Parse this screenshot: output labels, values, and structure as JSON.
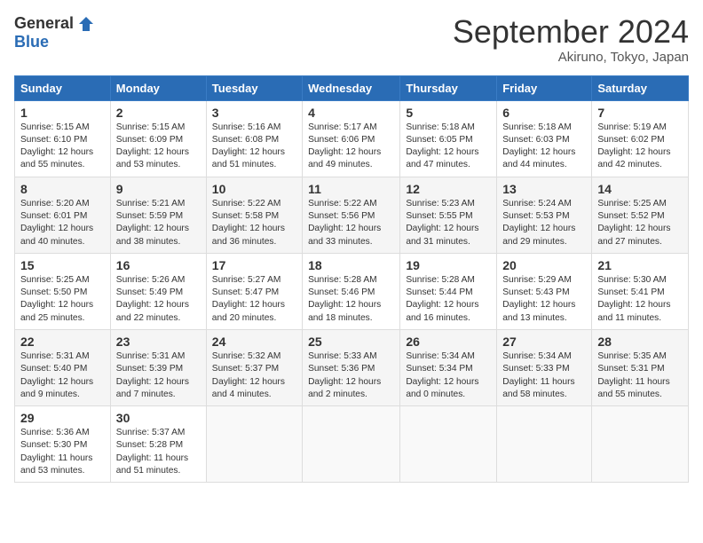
{
  "logo": {
    "general": "General",
    "blue": "Blue"
  },
  "title": "September 2024",
  "location": "Akiruno, Tokyo, Japan",
  "headers": [
    "Sunday",
    "Monday",
    "Tuesday",
    "Wednesday",
    "Thursday",
    "Friday",
    "Saturday"
  ],
  "weeks": [
    [
      {
        "day": "1",
        "info": "Sunrise: 5:15 AM\nSunset: 6:10 PM\nDaylight: 12 hours\nand 55 minutes."
      },
      {
        "day": "2",
        "info": "Sunrise: 5:15 AM\nSunset: 6:09 PM\nDaylight: 12 hours\nand 53 minutes."
      },
      {
        "day": "3",
        "info": "Sunrise: 5:16 AM\nSunset: 6:08 PM\nDaylight: 12 hours\nand 51 minutes."
      },
      {
        "day": "4",
        "info": "Sunrise: 5:17 AM\nSunset: 6:06 PM\nDaylight: 12 hours\nand 49 minutes."
      },
      {
        "day": "5",
        "info": "Sunrise: 5:18 AM\nSunset: 6:05 PM\nDaylight: 12 hours\nand 47 minutes."
      },
      {
        "day": "6",
        "info": "Sunrise: 5:18 AM\nSunset: 6:03 PM\nDaylight: 12 hours\nand 44 minutes."
      },
      {
        "day": "7",
        "info": "Sunrise: 5:19 AM\nSunset: 6:02 PM\nDaylight: 12 hours\nand 42 minutes."
      }
    ],
    [
      {
        "day": "8",
        "info": "Sunrise: 5:20 AM\nSunset: 6:01 PM\nDaylight: 12 hours\nand 40 minutes."
      },
      {
        "day": "9",
        "info": "Sunrise: 5:21 AM\nSunset: 5:59 PM\nDaylight: 12 hours\nand 38 minutes."
      },
      {
        "day": "10",
        "info": "Sunrise: 5:22 AM\nSunset: 5:58 PM\nDaylight: 12 hours\nand 36 minutes."
      },
      {
        "day": "11",
        "info": "Sunrise: 5:22 AM\nSunset: 5:56 PM\nDaylight: 12 hours\nand 33 minutes."
      },
      {
        "day": "12",
        "info": "Sunrise: 5:23 AM\nSunset: 5:55 PM\nDaylight: 12 hours\nand 31 minutes."
      },
      {
        "day": "13",
        "info": "Sunrise: 5:24 AM\nSunset: 5:53 PM\nDaylight: 12 hours\nand 29 minutes."
      },
      {
        "day": "14",
        "info": "Sunrise: 5:25 AM\nSunset: 5:52 PM\nDaylight: 12 hours\nand 27 minutes."
      }
    ],
    [
      {
        "day": "15",
        "info": "Sunrise: 5:25 AM\nSunset: 5:50 PM\nDaylight: 12 hours\nand 25 minutes."
      },
      {
        "day": "16",
        "info": "Sunrise: 5:26 AM\nSunset: 5:49 PM\nDaylight: 12 hours\nand 22 minutes."
      },
      {
        "day": "17",
        "info": "Sunrise: 5:27 AM\nSunset: 5:47 PM\nDaylight: 12 hours\nand 20 minutes."
      },
      {
        "day": "18",
        "info": "Sunrise: 5:28 AM\nSunset: 5:46 PM\nDaylight: 12 hours\nand 18 minutes."
      },
      {
        "day": "19",
        "info": "Sunrise: 5:28 AM\nSunset: 5:44 PM\nDaylight: 12 hours\nand 16 minutes."
      },
      {
        "day": "20",
        "info": "Sunrise: 5:29 AM\nSunset: 5:43 PM\nDaylight: 12 hours\nand 13 minutes."
      },
      {
        "day": "21",
        "info": "Sunrise: 5:30 AM\nSunset: 5:41 PM\nDaylight: 12 hours\nand 11 minutes."
      }
    ],
    [
      {
        "day": "22",
        "info": "Sunrise: 5:31 AM\nSunset: 5:40 PM\nDaylight: 12 hours\nand 9 minutes."
      },
      {
        "day": "23",
        "info": "Sunrise: 5:31 AM\nSunset: 5:39 PM\nDaylight: 12 hours\nand 7 minutes."
      },
      {
        "day": "24",
        "info": "Sunrise: 5:32 AM\nSunset: 5:37 PM\nDaylight: 12 hours\nand 4 minutes."
      },
      {
        "day": "25",
        "info": "Sunrise: 5:33 AM\nSunset: 5:36 PM\nDaylight: 12 hours\nand 2 minutes."
      },
      {
        "day": "26",
        "info": "Sunrise: 5:34 AM\nSunset: 5:34 PM\nDaylight: 12 hours\nand 0 minutes."
      },
      {
        "day": "27",
        "info": "Sunrise: 5:34 AM\nSunset: 5:33 PM\nDaylight: 11 hours\nand 58 minutes."
      },
      {
        "day": "28",
        "info": "Sunrise: 5:35 AM\nSunset: 5:31 PM\nDaylight: 11 hours\nand 55 minutes."
      }
    ],
    [
      {
        "day": "29",
        "info": "Sunrise: 5:36 AM\nSunset: 5:30 PM\nDaylight: 11 hours\nand 53 minutes."
      },
      {
        "day": "30",
        "info": "Sunrise: 5:37 AM\nSunset: 5:28 PM\nDaylight: 11 hours\nand 51 minutes."
      },
      {
        "day": "",
        "info": ""
      },
      {
        "day": "",
        "info": ""
      },
      {
        "day": "",
        "info": ""
      },
      {
        "day": "",
        "info": ""
      },
      {
        "day": "",
        "info": ""
      }
    ]
  ]
}
